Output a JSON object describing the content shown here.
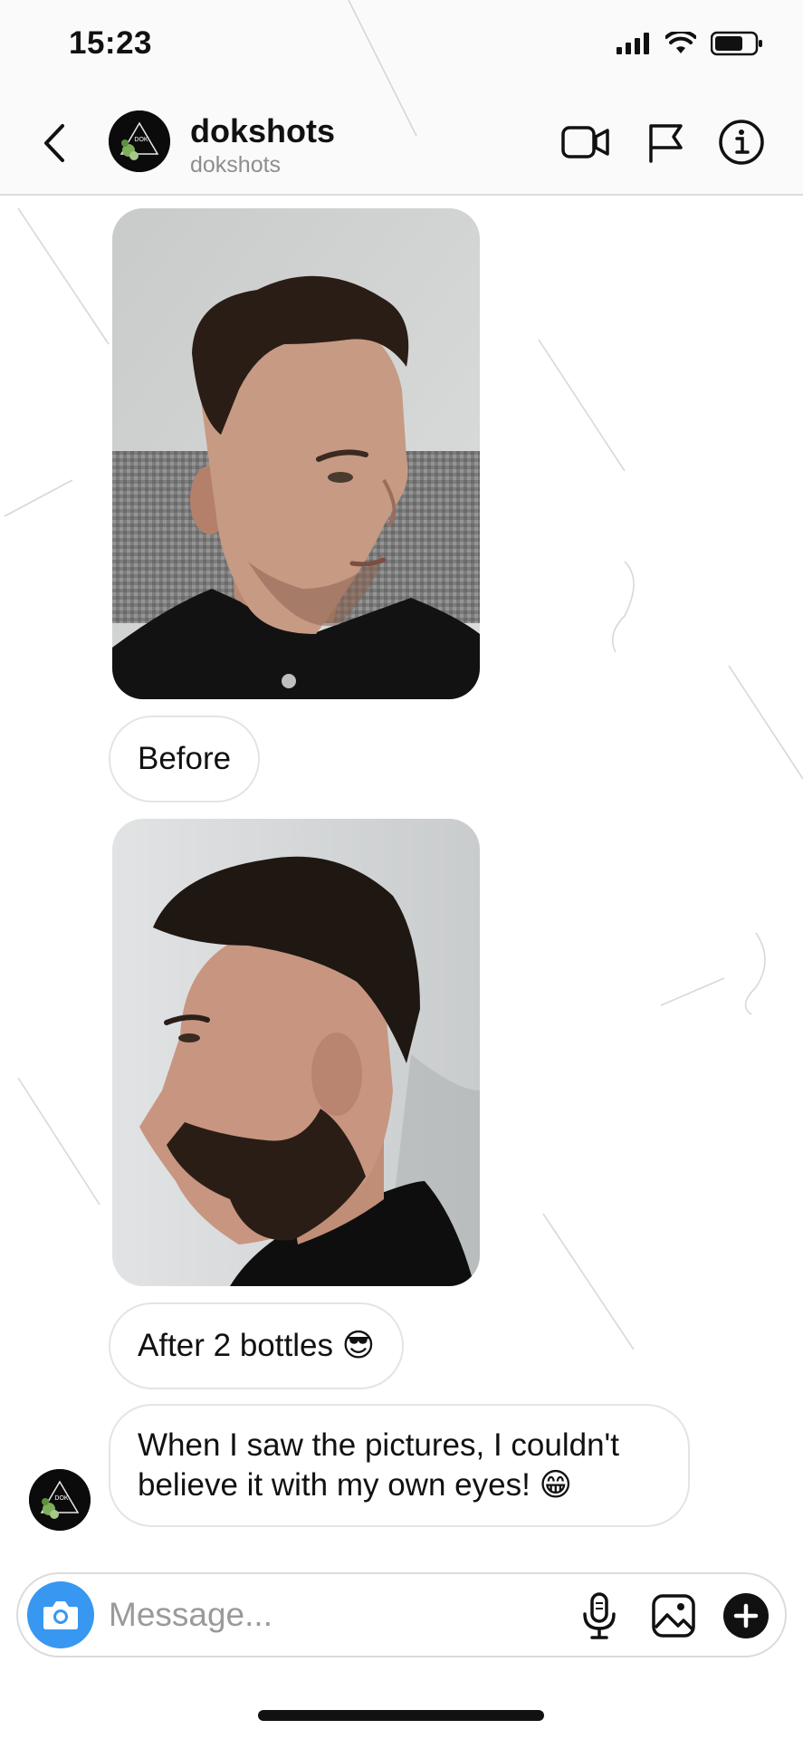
{
  "status_bar": {
    "time": "15:23",
    "icons": [
      "cellular-signal-icon",
      "wifi-icon",
      "battery-icon"
    ]
  },
  "header": {
    "title": "dokshots",
    "subtitle": "dokshots",
    "avatar_text": "DOK",
    "icons": [
      "back-chevron-icon",
      "video-call-icon",
      "flag-icon",
      "info-icon"
    ]
  },
  "messages": [
    {
      "type": "image",
      "description_icon": "photo-before"
    },
    {
      "type": "text",
      "text": "Before"
    },
    {
      "type": "image",
      "description_icon": "photo-after"
    },
    {
      "type": "text",
      "text": "After 2 bottles 😎"
    },
    {
      "type": "text",
      "line1": "When I saw the pictures, I couldn't",
      "line2": "believe it with my own eyes! 😁"
    }
  ],
  "composer": {
    "placeholder": "Message...",
    "icons": [
      "camera-icon",
      "microphone-icon",
      "gallery-icon",
      "plus-icon"
    ]
  },
  "colors": {
    "accent": "#3897f0",
    "bubble_border": "#e4e4e4",
    "header_bg": "#fafafa"
  }
}
